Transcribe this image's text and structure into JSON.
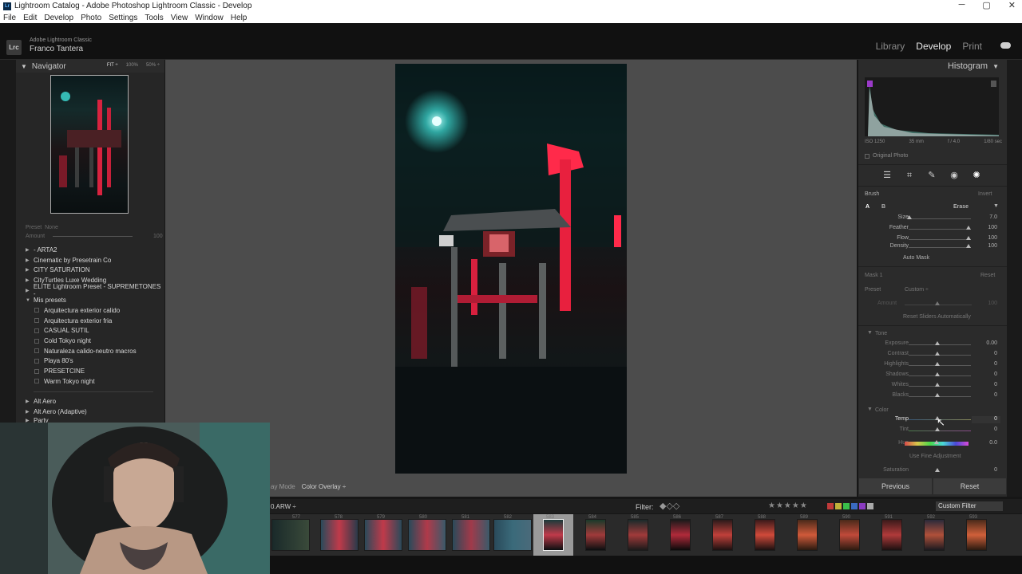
{
  "window": {
    "title": "Lightroom Catalog - Adobe Photoshop Lightroom Classic - Develop",
    "controls": [
      "─",
      "▢",
      "✕"
    ]
  },
  "menu": [
    "File",
    "Edit",
    "Develop",
    "Photo",
    "Settings",
    "Tools",
    "View",
    "Window",
    "Help"
  ],
  "identity": {
    "logo": "Lrc",
    "app": "Adobe Lightroom Classic",
    "user": "Franco Tantera"
  },
  "modules": {
    "library": "Library",
    "develop": "Develop",
    "print": "Print"
  },
  "navigator": {
    "title": "Navigator",
    "zoom": [
      "FIT ÷",
      "100%",
      "50% ÷"
    ]
  },
  "presets": {
    "preset_label": "Preset",
    "preset_value": "None",
    "amount_label": "Amount",
    "amount_value": "100",
    "groups_top": [
      {
        "label": "- ARTA2"
      },
      {
        "label": "Cinematic by Presetrain Co"
      },
      {
        "label": "CITY SATURATION"
      },
      {
        "label": "CityTurtles Luxe Wedding"
      },
      {
        "label": "ELITE Lightroom Preset - SUPREMETONES -"
      },
      {
        "label": "Mis presets"
      }
    ],
    "mis_presets": [
      "Arquitectura exterior calido",
      "Arquitectura exterior fria",
      "CASUAL SUTIL",
      "Cold Tokyo night",
      "Naturaleza calido-neutro macros",
      "Playa 80's",
      "PRESETCINE",
      "Warm Tokyo night"
    ],
    "groups_bottom": [
      "Alt Aero",
      "Alt Aero (Adaptive)",
      "Party"
    ]
  },
  "center_toolbar": {
    "mode_label": "ay Mode",
    "mode_value": "Color Overlay ÷"
  },
  "histogram": {
    "title": "Histogram",
    "meta": [
      "ISO 1250",
      "35 mm",
      "f / 4.0",
      "1/80 sec"
    ],
    "original_photo": "Original Photo"
  },
  "brush": {
    "title": "Brush",
    "invert": "Invert",
    "tabs": [
      "A",
      "B"
    ],
    "erase": "Erase",
    "sliders": [
      {
        "label": "Size",
        "value": "7.0"
      },
      {
        "label": "Feather",
        "value": "100"
      },
      {
        "label": "Flow",
        "value": "100"
      },
      {
        "label": "Density",
        "value": "100"
      }
    ],
    "auto_mask": "Auto Mask"
  },
  "mask": {
    "title": "Mask 1",
    "reset": "Reset",
    "preset_label": "Preset",
    "preset_value": "Custom ÷",
    "amount_label": "Amount",
    "amount_value": "100",
    "reset_sliders": "Reset Sliders Automatically"
  },
  "tone": {
    "title": "Tone",
    "sliders": [
      {
        "label": "Exposure",
        "value": "0.00"
      },
      {
        "label": "Contrast",
        "value": "0"
      },
      {
        "label": "Highlights",
        "value": "0"
      },
      {
        "label": "Shadows",
        "value": "0"
      },
      {
        "label": "Whites",
        "value": "0"
      },
      {
        "label": "Blacks",
        "value": "0"
      }
    ]
  },
  "color": {
    "title": "Color",
    "sliders": [
      {
        "label": "Temp",
        "value": "0"
      },
      {
        "label": "Tint",
        "value": "0"
      },
      {
        "label": "Hue",
        "value": "0.0"
      }
    ],
    "fine": "Use Fine Adjustment",
    "saturation": {
      "label": "Saturation",
      "value": "0"
    }
  },
  "buttons": {
    "previous": "Previous",
    "reset": "Reset"
  },
  "filmstrip": {
    "file": "0.ARW ÷",
    "filter_label": "Filter:",
    "custom_filter": "Custom Filter",
    "numbers": [
      "577",
      "578",
      "579",
      "580",
      "581",
      "582",
      "583",
      "584",
      "585",
      "586",
      "587",
      "588",
      "589",
      "590",
      "591",
      "592",
      "593"
    ]
  },
  "colors": {
    "accent_red": "#ff2a4a",
    "accent_cyan": "#3fe0d8",
    "panel": "#2b2b2b"
  }
}
